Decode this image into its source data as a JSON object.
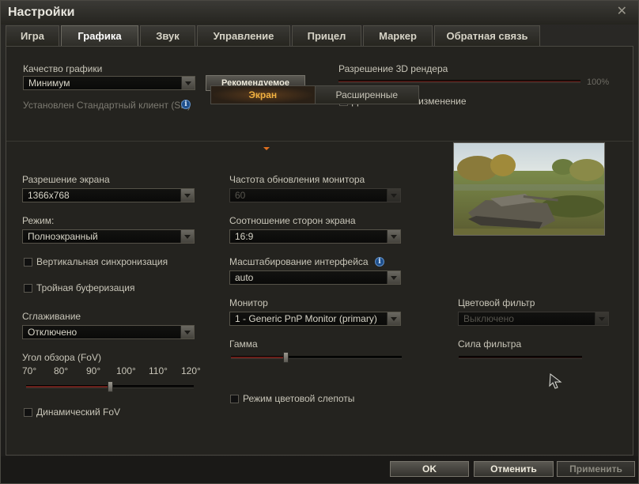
{
  "window": {
    "title": "Настройки",
    "close_icon": "close-icon"
  },
  "tabs": [
    {
      "label": "Игра"
    },
    {
      "label": "Графика"
    },
    {
      "label": "Звук"
    },
    {
      "label": "Управление"
    },
    {
      "label": "Прицел"
    },
    {
      "label": "Маркер"
    },
    {
      "label": "Обратная связь"
    }
  ],
  "graphics": {
    "quality_label": "Качество графики",
    "quality_value": "Минимум",
    "recommended_button": "Рекомендуемое",
    "client_info": "Установлен Стандартный клиент (SD)",
    "render_label": "Разрешение 3D рендера",
    "render_value": "100%",
    "render_fraction": 1.0,
    "dynamic_change_label": "Динамическое изменение",
    "dynamic_change_checked": true
  },
  "subtabs": {
    "screen": "Экран",
    "advanced": "Расширенные"
  },
  "left": {
    "resolution_label": "Разрешение экрана",
    "resolution_value": "1366x768",
    "mode_label": "Режим:",
    "mode_value": "Полноэкранный",
    "vsync_label": "Вертикальная синхронизация",
    "triple_label": "Тройная буферизация",
    "aa_label": "Сглаживание",
    "aa_value": "Отключено",
    "fov_label": "Угол обзора (FoV)",
    "fov_ticks": [
      "70°",
      "80°",
      "90°",
      "100°",
      "110°",
      "120°"
    ],
    "fov_value": 95,
    "dynamic_fov_label": "Динамический FoV"
  },
  "middle": {
    "refresh_label": "Частота обновления монитора",
    "refresh_value": "60",
    "aspect_label": "Соотношение сторон экрана",
    "aspect_value": "16:9",
    "scale_label": "Масштабирование интерфейса",
    "scale_value": "auto",
    "monitor_label": "Монитор",
    "monitor_value": "1 - Generic PnP Monitor (primary)",
    "gamma_label": "Гамма",
    "gamma_fraction": 0.32,
    "colorblind_label": "Режим цветовой слепоты"
  },
  "right": {
    "filter_label": "Цветовой фильтр",
    "filter_value": "Выключено",
    "strength_label": "Сила фильтра"
  },
  "buttons": {
    "ok": "OK",
    "cancel": "Отменить",
    "apply": "Применить"
  }
}
